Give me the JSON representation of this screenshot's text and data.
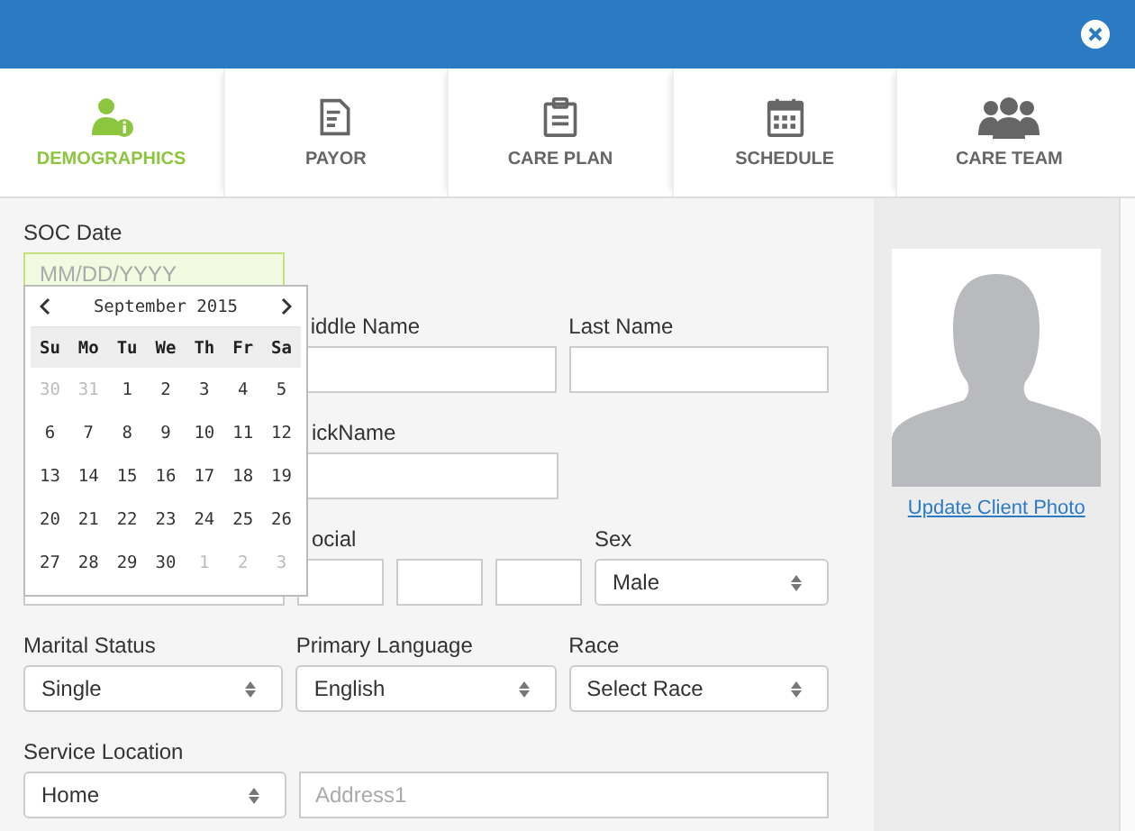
{
  "tabs": [
    {
      "label": "DEMOGRAPHICS",
      "selected": true
    },
    {
      "label": "PAYOR",
      "selected": false
    },
    {
      "label": "CARE PLAN",
      "selected": false
    },
    {
      "label": "SCHEDULE",
      "selected": false
    },
    {
      "label": "CARE TEAM",
      "selected": false
    }
  ],
  "soc_date": {
    "label": "SOC Date",
    "placeholder": "MM/DD/YYYY",
    "focused": true
  },
  "datepicker": {
    "title": "September 2015",
    "weekdays": [
      "Su",
      "Mo",
      "Tu",
      "We",
      "Th",
      "Fr",
      "Sa"
    ],
    "weeks": [
      [
        {
          "day": "30",
          "other_month": true
        },
        {
          "day": "31",
          "other_month": true
        },
        {
          "day": "1",
          "other_month": false
        },
        {
          "day": "2",
          "other_month": false
        },
        {
          "day": "3",
          "other_month": false
        },
        {
          "day": "4",
          "other_month": false
        },
        {
          "day": "5",
          "other_month": false
        }
      ],
      [
        {
          "day": "6",
          "other_month": false
        },
        {
          "day": "7",
          "other_month": false
        },
        {
          "day": "8",
          "other_month": false
        },
        {
          "day": "9",
          "other_month": false
        },
        {
          "day": "10",
          "other_month": false
        },
        {
          "day": "11",
          "other_month": false
        },
        {
          "day": "12",
          "other_month": false
        }
      ],
      [
        {
          "day": "13",
          "other_month": false
        },
        {
          "day": "14",
          "other_month": false
        },
        {
          "day": "15",
          "other_month": false
        },
        {
          "day": "16",
          "other_month": false
        },
        {
          "day": "17",
          "other_month": false
        },
        {
          "day": "18",
          "other_month": false
        },
        {
          "day": "19",
          "other_month": false
        }
      ],
      [
        {
          "day": "20",
          "other_month": false
        },
        {
          "day": "21",
          "other_month": false
        },
        {
          "day": "22",
          "other_month": false
        },
        {
          "day": "23",
          "other_month": false
        },
        {
          "day": "24",
          "other_month": false
        },
        {
          "day": "25",
          "other_month": false
        },
        {
          "day": "26",
          "other_month": false
        }
      ],
      [
        {
          "day": "27",
          "other_month": false
        },
        {
          "day": "28",
          "other_month": false
        },
        {
          "day": "29",
          "other_month": false
        },
        {
          "day": "30",
          "other_month": false
        },
        {
          "day": "1",
          "other_month": true
        },
        {
          "day": "2",
          "other_month": true
        },
        {
          "day": "3",
          "other_month": true
        }
      ]
    ]
  },
  "rows": [
    [
      {
        "kind": "covered"
      },
      {
        "kind": "text",
        "label": "iddle Name"
      },
      {
        "kind": "text",
        "label": "Last Name"
      }
    ],
    [
      {
        "kind": "covered"
      },
      {
        "kind": "text",
        "label": "ickName"
      }
    ],
    [
      {
        "kind": "text"
      },
      {
        "kind": "ssn",
        "label": "ocial"
      },
      {
        "kind": "select",
        "label": "Sex",
        "value": "Male"
      }
    ],
    [
      {
        "kind": "select",
        "label": "Marital Status",
        "value": "Single"
      },
      {
        "kind": "select",
        "label": "Primary Language",
        "value": "English"
      },
      {
        "kind": "select",
        "label": "Race",
        "value": "Select Race"
      }
    ],
    [
      {
        "kind": "select",
        "label": "Service Location",
        "value": "Home"
      },
      {
        "kind": "wide_text",
        "placeholder": "Address1"
      }
    ]
  ],
  "photo": {
    "link": "Update Client Photo"
  }
}
